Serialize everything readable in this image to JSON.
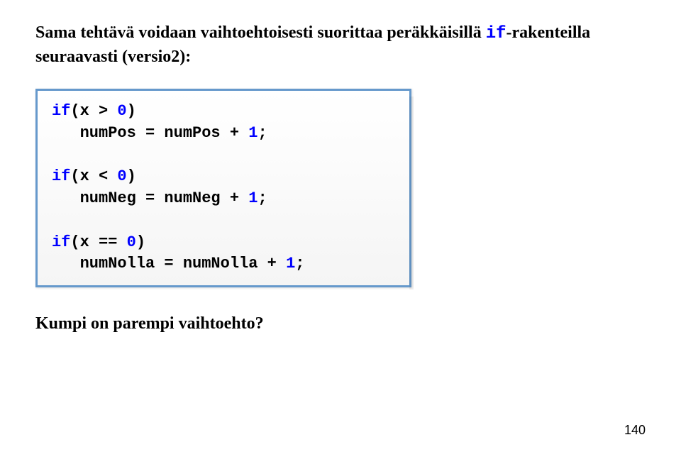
{
  "intro": {
    "part1": "Sama tehtävä voidaan vaihtoehtoisesti suorittaa peräkkäisillä ",
    "kw": "if",
    "part2": "-rakenteilla seuraavasti (versio2):"
  },
  "code": {
    "l1a": "if",
    "l1b": "(x > ",
    "l1c": "0",
    "l1d": ")",
    "l2a": "   numPos = numPos + ",
    "l2b": "1",
    "l2c": ";",
    "l3a": "if",
    "l3b": "(x < ",
    "l3c": "0",
    "l3d": ")",
    "l4a": "   numNeg = numNeg + ",
    "l4b": "1",
    "l4c": ";",
    "l5a": "if",
    "l5b": "(x == ",
    "l5c": "0",
    "l5d": ")",
    "l6a": "   numNolla = numNolla + ",
    "l6b": "1",
    "l6c": ";"
  },
  "question": "Kumpi on parempi vaihtoehto?",
  "pageNumber": "140"
}
